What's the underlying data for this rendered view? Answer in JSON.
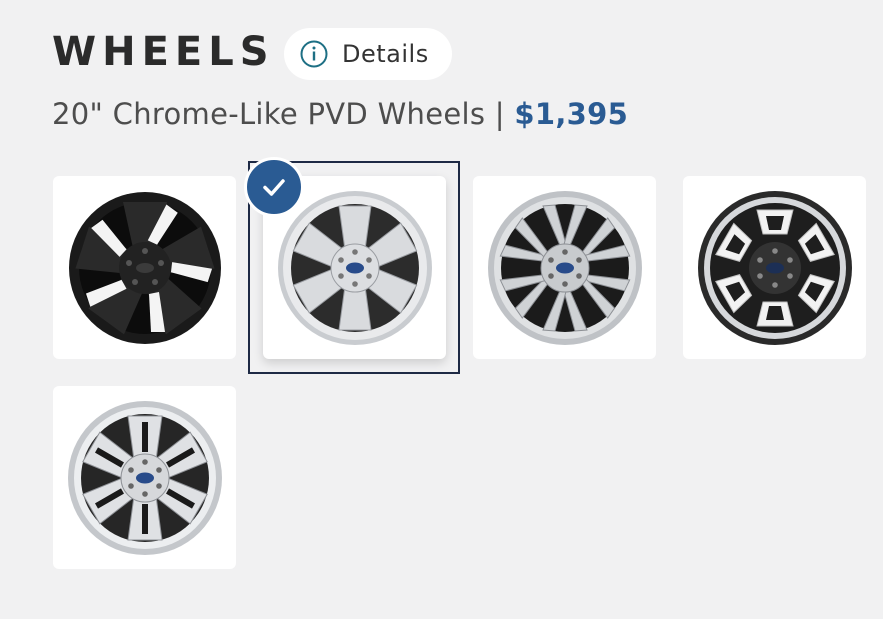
{
  "section": {
    "title": "WHEELS",
    "details_label": "Details",
    "info_icon": "info-circle-icon",
    "selection_name": "20\" Chrome-Like PVD Wheels | ",
    "selection_price": "$1,395"
  },
  "colors": {
    "accent": "#2a5b93",
    "selected_border": "#1e2a45",
    "background": "#f1f1f2",
    "info_icon": "#1d6f84"
  },
  "wheels": {
    "selected_index": 1,
    "options": [
      {
        "style": "black-5-spoke"
      },
      {
        "style": "chrome-6-spoke"
      },
      {
        "style": "split-spoke-machined"
      },
      {
        "style": "hex-pocket-black-machined"
      },
      {
        "style": "chrome-6-spoke-black-inserts"
      }
    ]
  }
}
